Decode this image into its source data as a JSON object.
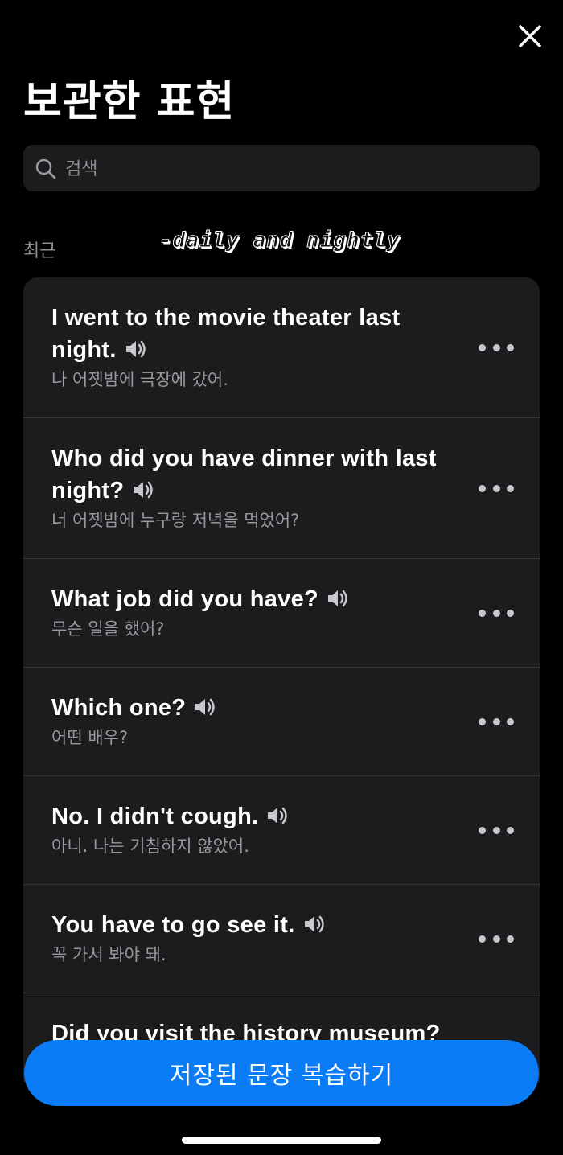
{
  "header": {
    "title": "보관한 표현",
    "close_icon": "close-icon"
  },
  "search": {
    "placeholder": "검색",
    "icon": "search-icon"
  },
  "section": {
    "recent_label": "최근",
    "watermark": "-daily and nightly"
  },
  "items": [
    {
      "english": "I went to the movie theater last night.",
      "korean": "나 어젯밤에 극장에 갔어.",
      "icon": "speaker-icon"
    },
    {
      "english": "Who did you have dinner with last night?",
      "korean": "너 어젯밤에 누구랑 저녁을 먹었어?",
      "icon": "speaker-icon"
    },
    {
      "english": "What job did you have?",
      "korean": "무슨 일을 했어?",
      "icon": "speaker-icon"
    },
    {
      "english": "Which one?",
      "korean": "어떤 배우?",
      "icon": "speaker-icon"
    },
    {
      "english": "No. I didn't cough.",
      "korean": "아니. 나는 기침하지 않았어.",
      "icon": "speaker-icon"
    },
    {
      "english": "You have to go see it.",
      "korean": "꼭 가서 봐야 돼.",
      "icon": "speaker-icon"
    },
    {
      "english": "Did you visit the history museum?",
      "korean": "",
      "icon": "speaker-icon"
    }
  ],
  "footer": {
    "review_button": "저장된 문장 복습하기"
  },
  "colors": {
    "background": "#000000",
    "card": "#1c1c1e",
    "accent": "#0a7cf5",
    "secondary_text": "#98989d"
  }
}
